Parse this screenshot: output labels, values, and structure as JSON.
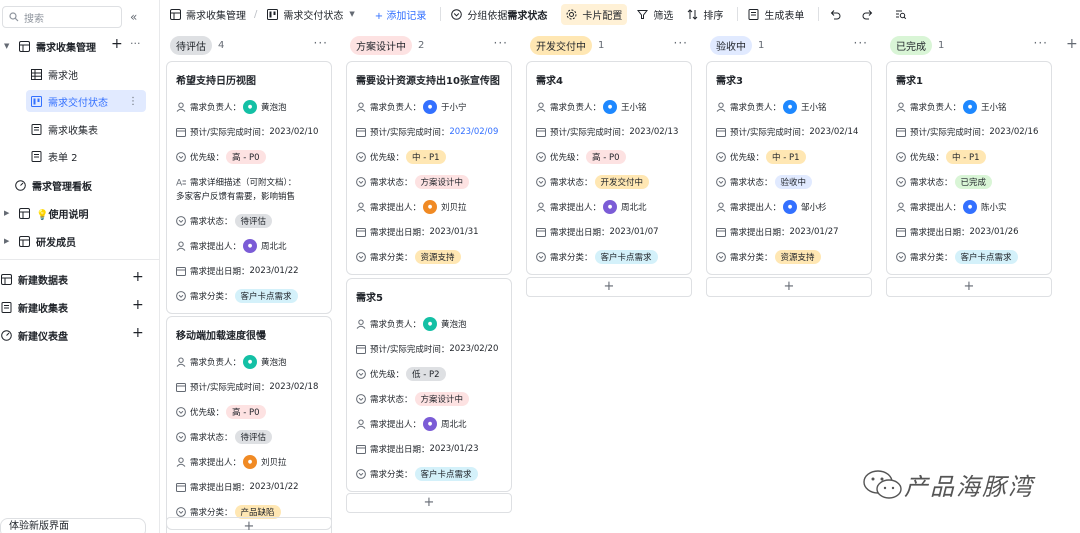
{
  "sidebar": {
    "search_placeholder": "搜索",
    "collapse": "«",
    "tree": [
      {
        "label": "需求收集管理",
        "icon": "table-icon"
      },
      {
        "label": "需求池",
        "icon": "grid-icon"
      },
      {
        "label": "需求交付状态",
        "icon": "kanban-icon"
      },
      {
        "label": "需求收集表",
        "icon": "form-icon"
      },
      {
        "label": "表单 2",
        "icon": "form-icon"
      },
      {
        "label": "需求管理看板",
        "icon": "dashboard-icon"
      },
      {
        "label": "💡使用说明",
        "icon": "table-icon"
      },
      {
        "label": "研发成员",
        "icon": "table-icon"
      }
    ],
    "create": [
      {
        "label": "新建数据表"
      },
      {
        "label": "新建收集表"
      },
      {
        "label": "新建仪表盘"
      }
    ],
    "new_ui": "体验新版界面"
  },
  "toolbar": {
    "table_name": "需求收集管理",
    "view_name": "需求交付状态",
    "add_record": "+ 添加记录",
    "group_prefix": "分组依据 ",
    "group_field": "需求状态",
    "card_config": "卡片配置",
    "filter": "筛选",
    "sort": "排序",
    "gen_form": "生成表单"
  },
  "colors": {
    "accent": "#3370ff",
    "red": "#fde2e2",
    "orange": "#ffe7b3",
    "green": "#d9f5d6",
    "blue": "#e1eaff",
    "gray": "#dee0e3",
    "cyan": "#d4f1fa"
  },
  "fields": {
    "owner": "需求负责人：",
    "deadline": "预计/实际完成时间：",
    "priority": "优先级：",
    "desc": "需求详细描述（可附文档）：",
    "status": "需求状态：",
    "proposer": "需求提出人：",
    "date": "需求提出日期：",
    "category": "需求分类："
  },
  "columns": [
    {
      "name": "待评估",
      "count": "4",
      "cards": [
        {
          "title": "希望支持日历视图",
          "owner": "黄泡泡",
          "deadline": "2023/02/10",
          "priority": "高 - P0",
          "desc": "多家客户反馈有需要，影响销售",
          "status": "待评估",
          "proposer": "周北北",
          "date": "2023/01/22",
          "category": "客户卡点需求"
        },
        {
          "title": "移动端加载速度很慢",
          "owner": "黄泡泡",
          "deadline": "2023/02/18",
          "priority": "高 - P0",
          "status": "待评估",
          "proposer": "刘贝拉",
          "date": "2023/01/22",
          "category": "产品缺陷"
        }
      ]
    },
    {
      "name": "方案设计中",
      "count": "2",
      "cards": [
        {
          "title": "需要设计资源支持出10张宣传图",
          "owner": "于小宁",
          "deadline": "2023/02/09",
          "priority": "中 - P1",
          "status": "方案设计中",
          "proposer": "刘贝拉",
          "date": "2023/01/31",
          "category": "资源支持"
        },
        {
          "title": "需求5",
          "owner": "黄泡泡",
          "deadline": "2023/02/20",
          "priority": "低 - P2",
          "status": "方案设计中",
          "proposer": "周北北",
          "date": "2023/01/23",
          "category": "客户卡点需求"
        }
      ]
    },
    {
      "name": "开发交付中",
      "count": "1",
      "cards": [
        {
          "title": "需求4",
          "owner": "王小铭",
          "deadline": "2023/02/13",
          "priority": "高 - P0",
          "status": "开发交付中",
          "proposer": "周北北",
          "date": "2023/01/07",
          "category": "客户卡点需求"
        }
      ]
    },
    {
      "name": "验收中",
      "count": "1",
      "cards": [
        {
          "title": "需求3",
          "owner": "王小铭",
          "deadline": "2023/02/14",
          "priority": "中 - P1",
          "status": "验收中",
          "proposer": "邹小杉",
          "date": "2023/01/27",
          "category": "资源支持"
        }
      ]
    },
    {
      "name": "已完成",
      "count": "1",
      "cards": [
        {
          "title": "需求1",
          "owner": "王小铭",
          "deadline": "2023/02/16",
          "priority": "中 - P1",
          "status": "已完成",
          "proposer": "陈小实",
          "date": "2023/01/26",
          "category": "客户卡点需求"
        }
      ]
    }
  ],
  "watermark": "产品海豚湾"
}
